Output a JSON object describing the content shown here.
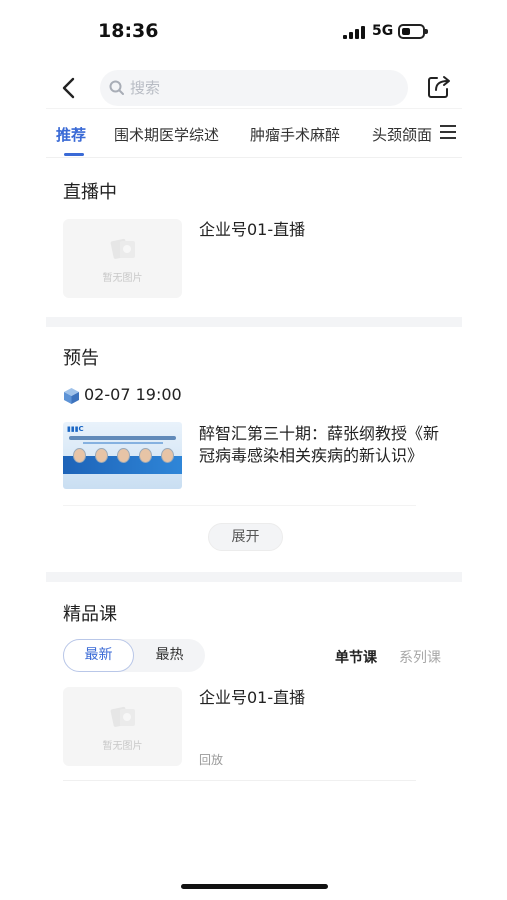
{
  "status_bar": {
    "time": "18:36",
    "network": "5G"
  },
  "search": {
    "placeholder": "搜索"
  },
  "tabs": [
    {
      "label": "推荐",
      "active": true
    },
    {
      "label": "围术期医学综述"
    },
    {
      "label": "肿瘤手术麻醉"
    },
    {
      "label": "头颈颌面"
    }
  ],
  "live": {
    "title": "直播中",
    "items": [
      {
        "title": "企业号01-直播",
        "image_placeholder": "暂无图片"
      }
    ]
  },
  "preview": {
    "title": "预告",
    "date_time": "02-07 19:00",
    "items": [
      {
        "title": "醉智汇第三十期：薛张纲教授《新冠病毒感染相关疾病的新认识》"
      }
    ],
    "expand_label": "展开"
  },
  "courses": {
    "title": "精品课",
    "sort_options": [
      "最新",
      "最热"
    ],
    "kind_tabs": [
      "单节课",
      "系列课"
    ],
    "items": [
      {
        "title": "企业号01-直播",
        "image_placeholder": "暂无图片",
        "status": "回放"
      }
    ]
  },
  "colors": {
    "accent": "#3a6ad6",
    "muted": "#a8a8a8",
    "band": "#f3f4f6"
  }
}
